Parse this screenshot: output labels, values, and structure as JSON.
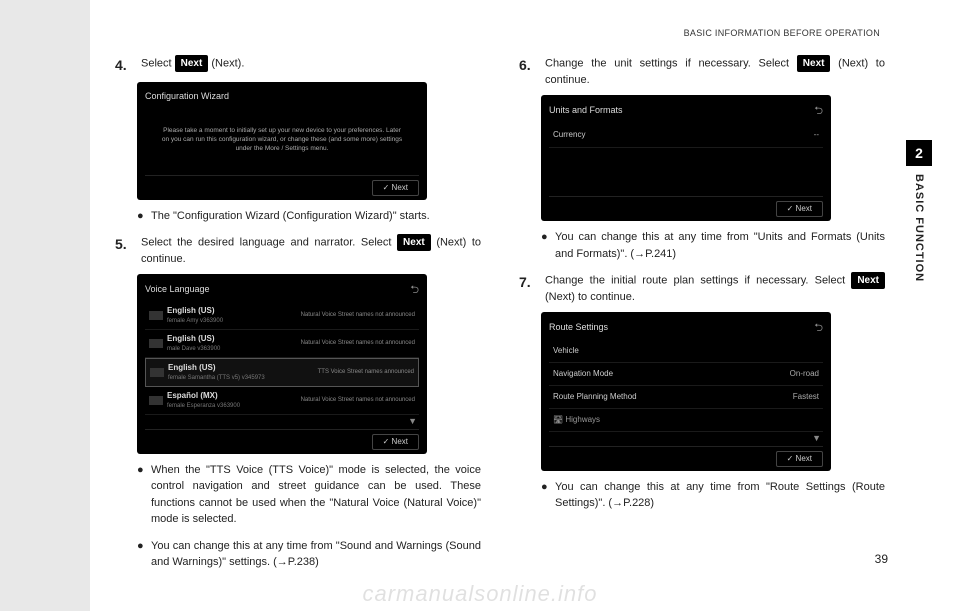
{
  "header": {
    "title": "BASIC INFORMATION BEFORE OPERATION"
  },
  "sideTab": {
    "number": "2",
    "label": "BASIC FUNCTION"
  },
  "pageNumber": "39",
  "watermark": "carmanualsonline.info",
  "nextBtn": "Next",
  "left": {
    "step4": {
      "num": "4.",
      "pre": "Select ",
      "post": " (Next)."
    },
    "screen4": {
      "title": "Configuration Wizard",
      "body": "Please take a moment to initially set up your new device to your preferences. Later on you can run this configuration wizard, or change these (and some more) settings under the More / Settings menu.",
      "next": "✓  Next"
    },
    "bullet4": "The \"Configuration Wizard (Configuration Wizard)\" starts.",
    "step5": {
      "num": "5.",
      "pre": "Select the desired language and narrator. Select ",
      "post": " (Next) to continue."
    },
    "screen5": {
      "title": "Voice Language",
      "rows": [
        {
          "name": "English (US)",
          "sub": "female\nAmy v363900",
          "right": "Natural Voice\nStreet names\nnot announced",
          "sel": false
        },
        {
          "name": "English (US)",
          "sub": "male\nDave v363900",
          "right": "Natural Voice\nStreet names\nnot announced",
          "sel": false
        },
        {
          "name": "English (US)",
          "sub": "female\nSamantha (TTS v5) v345973",
          "right": "TTS Voice\nStreet names\nannounced",
          "sel": true
        },
        {
          "name": "Español (MX)",
          "sub": "female\nEsperanza v363900",
          "right": "Natural Voice\nStreet names\nnot announced",
          "sel": false
        }
      ],
      "next": "✓  Next"
    },
    "bullet5a": "When the \"TTS Voice (TTS Voice)\" mode is selected, the voice control navigation and street guidance can be used. These functions cannot be used when the \"Natural Voice (Natural Voice)\" mode is selected.",
    "bullet5b": "You can change this at any time from \"Sound and Warnings (Sound and Warnings)\" settings. (→P.238)"
  },
  "right": {
    "step6": {
      "num": "6.",
      "pre": "Change the unit settings if necessary. Select ",
      "post": " (Next) to continue."
    },
    "screen6": {
      "title": "Units and Formats",
      "rows": [
        {
          "label": "Currency",
          "value": "--"
        }
      ],
      "next": "✓  Next"
    },
    "bullet6": "You can change this at any time from \"Units and Formats (Units and Formats)\". (→P.241)",
    "step7": {
      "num": "7.",
      "pre": "Change the initial route plan settings if necessary. Select ",
      "post": " (Next) to continue."
    },
    "screen7": {
      "title": "Route Settings",
      "rows": [
        {
          "label": "Vehicle",
          "value": ""
        },
        {
          "label": "Navigation Mode",
          "value": "On-road"
        },
        {
          "label": "Route Planning Method",
          "value": "Fastest"
        },
        {
          "label": "🛣  Highways",
          "value": ""
        }
      ],
      "next": "✓  Next"
    },
    "bullet7": "You can change this at any time from \"Route Settings (Route Settings)\". (→P.228)"
  }
}
